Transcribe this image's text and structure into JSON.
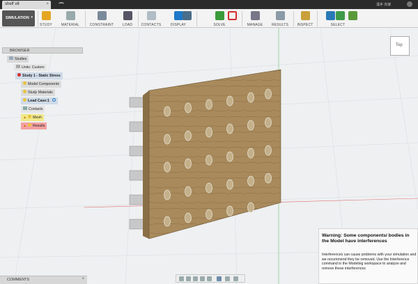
{
  "title_bar": {
    "file_tab": "shelf v8",
    "user_label": "濱手 内家"
  },
  "toolbar": {
    "workspace": "SIMULATION",
    "groups": [
      {
        "label": "STUDY",
        "icon": "study-icon"
      },
      {
        "label": "MATERIAL",
        "icon": "material-icon"
      },
      {
        "label": "CONSTRAINT",
        "icon": "constraint-icon"
      },
      {
        "label": "LOAD",
        "icon": "load-icon"
      },
      {
        "label": "CONTACTS",
        "icon": "contacts-icon"
      },
      {
        "label": "DISPLAY",
        "icon": "display-icon"
      },
      {
        "label": "SOLVE",
        "icon": "solve-icon"
      },
      {
        "label": "MANAGE",
        "icon": "manage-icon"
      },
      {
        "label": "RESULTS",
        "icon": "results-icon"
      },
      {
        "label": "INSPECT",
        "icon": "inspect-icon"
      },
      {
        "label": "SELECT",
        "icon": "select-icon"
      }
    ]
  },
  "browser": {
    "title": "BROWSER",
    "items": [
      {
        "label": "Studies"
      },
      {
        "label": "Units: Custom"
      },
      {
        "label": "Study 1 - Static Stress"
      },
      {
        "label": "Model Components"
      },
      {
        "label": "Study Materials"
      },
      {
        "label": "Load Case:1"
      },
      {
        "label": "Contacts"
      },
      {
        "label": "Mesh"
      },
      {
        "label": "Results"
      }
    ]
  },
  "comments": {
    "title": "COMMENTS"
  },
  "viewcube": {
    "face": "Top"
  },
  "warning": {
    "title": "Warning: Some components/ bodies in the Model have interferences",
    "body": "Interferences can cause problems with your simulation and we recommend they be removed. Use the Interference command in the Modeling workspace to analyze and remove these interferences"
  },
  "colors": {
    "wood": "#a88a5c",
    "accent_blue": "#1f78c8",
    "study_red": "#d32f2f"
  }
}
